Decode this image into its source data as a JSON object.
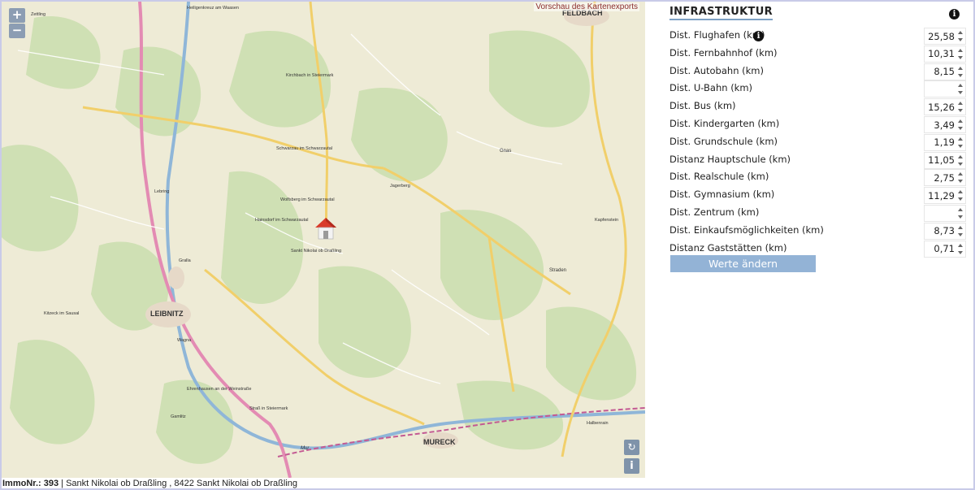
{
  "map": {
    "zoom_in": "+",
    "zoom_out": "−",
    "export_link": "Vorschau des Kartenexports",
    "refresh_icon": "↻",
    "info_icon": "i",
    "labels": {
      "feldbach": "FELDBACH",
      "leibnitz": "LEIBNITZ",
      "mureck": "MURECK",
      "sankt_nikolai": "Sankt Nikolai ob Draßling",
      "wolfsberg": "Wolfsberg im Schwarzautal",
      "schwarzau": "Schwarzau im Schwarzautal",
      "hainsdorf": "Hainsdorf im Schwarzautal",
      "kirchbach": "Kirchbach in Steiermark",
      "gnas": "Gnas",
      "straden": "Straden",
      "wagna": "Wagna",
      "gralla": "Gralla",
      "lebring": "Lebring",
      "kitzeck": "Kitzeck im Sausal",
      "heiligenkreuz": "Heiligenkreuz am Waasen",
      "zettling": "Zettling",
      "strass": "Straß in Steiermark",
      "jagerberg": "Jagerberg",
      "kapfenstein": "Kapfenstein",
      "halbenrain": "Halbenrain",
      "gamlitz": "Gamlitz",
      "ehrenhausen": "Ehrenhausen an der Weinstraße",
      "mur": "Mur"
    }
  },
  "footer": {
    "immo_label": "ImmoNr.: 393",
    "separator": "|",
    "address": "Sankt Nikolai ob Draßling , 8422 Sankt Nikolai ob Draßling"
  },
  "panel": {
    "title": "INFRASTRUKTUR",
    "info_icon": "i",
    "rows": [
      {
        "label": "Dist. Flughafen (km)",
        "value": "25,58"
      },
      {
        "label": "Dist. Fernbahnhof (km)",
        "value": "10,31"
      },
      {
        "label": "Dist. Autobahn (km)",
        "value": "8,15"
      },
      {
        "label": "Dist. U-Bahn (km)",
        "value": ""
      },
      {
        "label": "Dist. Bus (km)",
        "value": "15,26"
      },
      {
        "label": "Dist. Kindergarten (km)",
        "value": "3,49"
      },
      {
        "label": "Dist. Grundschule (km)",
        "value": "1,19"
      },
      {
        "label": "Distanz Hauptschule (km)",
        "value": "11,05"
      },
      {
        "label": "Dist. Realschule (km)",
        "value": "2,75"
      },
      {
        "label": "Dist. Gymnasium (km)",
        "value": "11,29"
      },
      {
        "label": "Dist. Zentrum (km)",
        "value": ""
      },
      {
        "label": "Dist. Einkaufsmöglichkeiten (km)",
        "value": "8,73"
      },
      {
        "label": "Distanz Gaststätten (km)",
        "value": "0,71"
      }
    ],
    "save_label": "Werte ändern"
  },
  "colors": {
    "map_bg": "#eeebd6",
    "forest": "#c9dcae",
    "road_main": "#f4d36b",
    "road_highway": "#e38bb3",
    "river": "#8fb6d8",
    "button": "#93b3d6",
    "title_underline": "#7ea1c4"
  }
}
